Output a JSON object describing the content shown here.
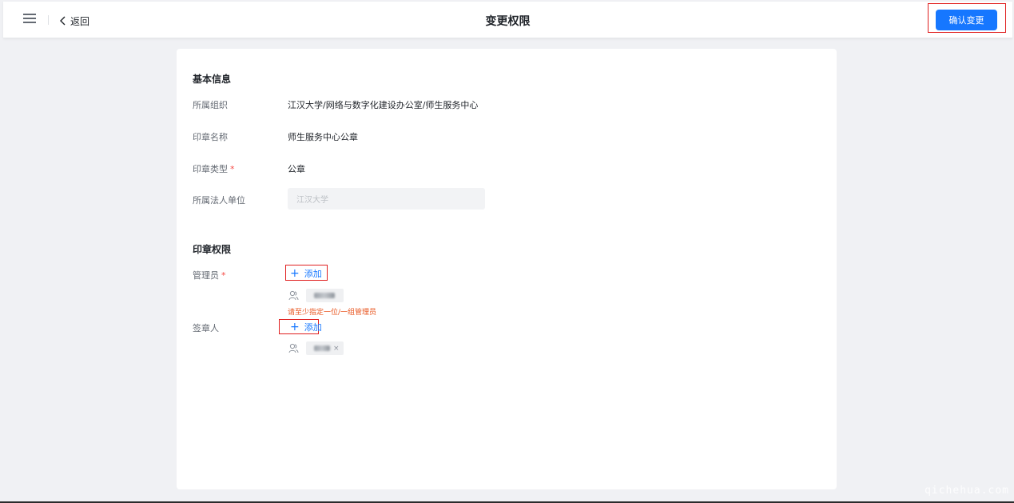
{
  "header": {
    "back_label": "返回",
    "title": "变更权限",
    "confirm_label": "确认变更"
  },
  "basic_info": {
    "section_title": "基本信息",
    "fields": [
      {
        "label": "所属组织",
        "value": "江汉大学/网络与数字化建设办公室/师生服务中心"
      },
      {
        "label": "印章名称",
        "value": "师生服务中心公章"
      },
      {
        "label": "印章类型",
        "required_mark": "*",
        "value": "公章"
      },
      {
        "label": "所属法人单位",
        "placeholder": "江汉大学"
      }
    ]
  },
  "permissions": {
    "section_title": "印章权限",
    "admin": {
      "label": "管理员",
      "required_mark": "*",
      "add_label": "添加",
      "error": "请至少指定一位/一组管理员"
    },
    "signer": {
      "label": "签章人",
      "add_label": "添加",
      "chip_close": "×"
    }
  },
  "watermark": "qichehua.com",
  "colors": {
    "primary": "#1677ff",
    "error": "#e8541e",
    "highlight_box": "#e02020"
  }
}
